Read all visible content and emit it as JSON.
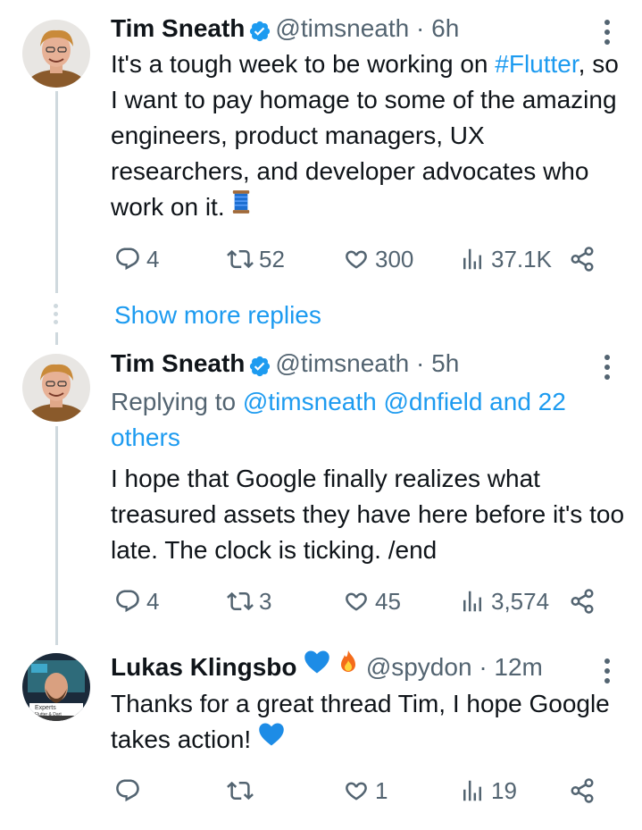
{
  "tweets": [
    {
      "name": "Tim Sneath",
      "handle": "@timsneath",
      "time": "· 6h",
      "text_pre": "It's a tough week to be working on ",
      "hashtag": "#Flutter",
      "text_post": ", so I want to pay homage to some of the amazing engineers, product managers, UX researchers, and developer advocates who work on it.",
      "reply_count": "4",
      "retweet_count": "52",
      "like_count": "300",
      "view_count": "37.1K"
    },
    {
      "name": "Tim Sneath",
      "handle": "@timsneath",
      "time": "· 5h",
      "replying_prefix": "Replying to",
      "replying_to": "@timsneath @dnfield and 22 others",
      "text": "I hope that Google finally realizes what treasured assets they have here before it's too late. The clock is ticking. /end",
      "reply_count": "4",
      "retweet_count": "3",
      "like_count": "45",
      "view_count": "3,574"
    },
    {
      "name": "Lukas Klingsbo",
      "handle": "@spydon",
      "time": "· 12m",
      "avatar_badge": "Experts",
      "avatar_badge_sub": "Flutter & Dart",
      "text": "Thanks for a great thread Tim, I hope Google takes action!",
      "reply_count": "",
      "retweet_count": "",
      "like_count": "1",
      "view_count": "19"
    }
  ],
  "show_more_replies": "Show more replies",
  "icons": {
    "verified": "verified-badge-icon",
    "reply": "reply-icon",
    "retweet": "retweet-icon",
    "like": "heart-icon",
    "views": "views-icon",
    "share": "share-icon",
    "more": "more-options-icon",
    "thread": "thread-spool-icon",
    "blue_heart": "blue-heart-icon",
    "fire": "fire-icon"
  },
  "colors": {
    "accent": "#1d9bf0",
    "muted": "#536471",
    "text": "#0f1419",
    "thread_line": "#cfd9de"
  }
}
